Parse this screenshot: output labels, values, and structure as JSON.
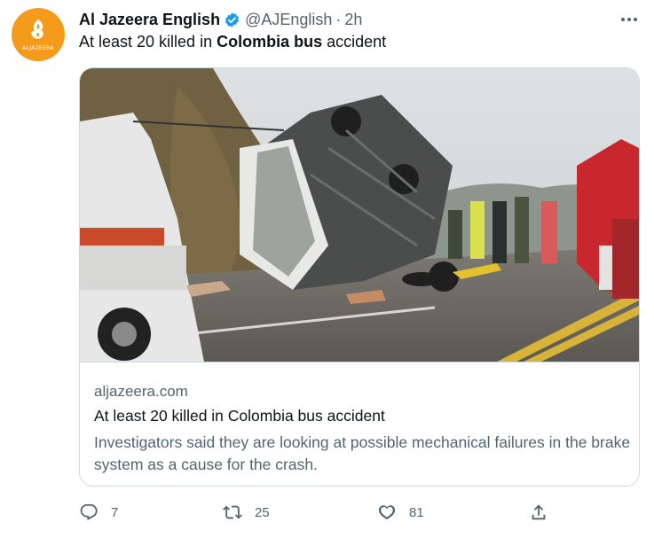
{
  "author": {
    "avatar_icon": "aljazeera-logo-icon",
    "avatar_brand_text": "ALJAZEERA",
    "display_name": "Al Jazeera English",
    "verified_icon": "verified-badge-icon",
    "handle": "@AJEnglish",
    "separator": "·",
    "time": "2h"
  },
  "more_icon": "more-options-icon",
  "tweet": {
    "text_prefix": "At least 20 killed in ",
    "text_bold": "Colombia bus",
    "text_suffix": " accident"
  },
  "card": {
    "image_description_icon": "bus-crash-photo",
    "domain": "aljazeera.com",
    "title": "At least 20 killed in Colombia bus accident",
    "description": "Investigators said they are looking at possible mechanical failures in the brake system as a cause for the crash."
  },
  "actions": {
    "reply": {
      "icon": "reply-icon",
      "count": "7"
    },
    "retweet": {
      "icon": "retweet-icon",
      "count": "25"
    },
    "like": {
      "icon": "like-heart-icon",
      "count": "81"
    },
    "share": {
      "icon": "share-icon"
    }
  },
  "colors": {
    "brand_orange": "#f59b1c",
    "verified_blue": "#1d9bf0",
    "secondary_text": "#536471",
    "border": "#cfd9de"
  }
}
